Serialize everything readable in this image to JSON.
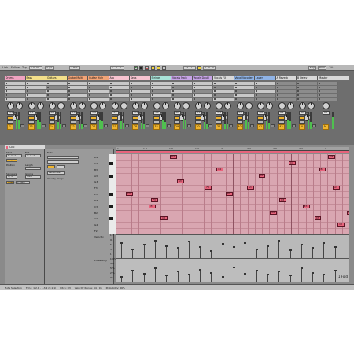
{
  "transport": {
    "link": "Link",
    "follow": "Follow",
    "tap": "Tap",
    "tempo": "120.00",
    "metre": "4 / 4",
    "quant": "1 Bar",
    "position": "1 . 1 . 1",
    "loop_start": "23 . 1 . 1",
    "loop_len": "4 . 0 . 0",
    "key": "Key",
    "midi": "MIDI",
    "cpu": "1%"
  },
  "tracks": [
    {
      "name": "Drums",
      "color": "#f0a3c1",
      "num": "1",
      "vol": "-3.4",
      "meter": 0.6
    },
    {
      "name": "Bass",
      "color": "#f4e08a",
      "num": "13",
      "vol": "-6.1",
      "meter": 0.5
    },
    {
      "name": "Guitars",
      "color": "#f4e08a",
      "num": "14",
      "vol": "-4.2",
      "meter": 0.4
    },
    {
      "name": "Guitar Multi",
      "color": "#f2a477",
      "num": "22",
      "vol": "-2.8",
      "meter": 0.3
    },
    {
      "name": "Guitar High",
      "color": "#f2a477",
      "num": "24",
      "vol": "-5.0",
      "meter": 0.55
    },
    {
      "name": "Arp",
      "color": "#f7c3d0",
      "num": "27",
      "vol": "-1.2",
      "meter": 0.45
    },
    {
      "name": "Keys",
      "color": "#f7c3d0",
      "num": "28",
      "vol": "-4.5",
      "meter": 0.35
    },
    {
      "name": "Strings",
      "color": "#a8e3d8",
      "num": "33",
      "vol": "-3.0",
      "meter": 0.5
    },
    {
      "name": "Vocals Main",
      "color": "#c7a4e6",
      "num": "29",
      "vol": "-6.0",
      "meter": 0.6
    },
    {
      "name": "Vocals Doubl",
      "color": "#c7a4e6",
      "num": "30",
      "vol": "-2.1",
      "meter": 0.4
    },
    {
      "name": "Vocals FX",
      "color": "#d9d9d9",
      "num": "36",
      "vol": "-7.5",
      "meter": 0.3
    },
    {
      "name": "Vocal Vocoder",
      "color": "#8fb3e6",
      "num": "40",
      "vol": "-3.3",
      "meter": 0.5
    },
    {
      "name": "Layer",
      "color": "#8fb3e6",
      "num": "41",
      "vol": "-4.0",
      "meter": 0.45
    },
    {
      "name": "A Reverb",
      "color": "#d9d9d9",
      "num": "42",
      "vol": "-6.2",
      "meter": 0.55
    },
    {
      "name": "B Delay",
      "color": "#d9d9d9",
      "num": "A",
      "vol": "-8.0",
      "meter": 0.5
    }
  ],
  "master": {
    "name": "Master",
    "num": "M",
    "vol": "0.0"
  },
  "sends_label": "Sends",
  "clip": {
    "title": "Clip",
    "start_label": "Start",
    "end_label": "End",
    "position_label": "Position",
    "length_label": "Length",
    "loop_label": "Loop",
    "signature_label": "Signature",
    "groove_label": "Groove",
    "scale_label": "Scale",
    "signature_value": "4 / 4",
    "groove_value": "None",
    "start_value": "1 . 1 . 1",
    "end_value": "5 . 1 . 1",
    "loop_value": "4 . 0 . 0",
    "scale_value": "C Major"
  },
  "notes_panel": {
    "title": "Notes",
    "randomize": "Randomize",
    "velocity_range": "Velocity Range"
  },
  "ruler": [
    "1",
    "1.2",
    "1.3",
    "1.4",
    "2",
    "2.2",
    "2.3",
    "2.4",
    "3"
  ],
  "pitch_labels": [
    "D4",
    "C4",
    "B3",
    "A3",
    "G3",
    "F3",
    "E3",
    "D3",
    "C3",
    "B2",
    "A2",
    "G2",
    "F2"
  ],
  "notes": [
    {
      "label": "G3",
      "pitch": 7,
      "start": 0.04,
      "len": 0.03
    },
    {
      "label": "E3",
      "pitch": 9,
      "start": 0.14,
      "len": 0.03
    },
    {
      "label": "F3",
      "pitch": 8,
      "start": 0.15,
      "len": 0.03
    },
    {
      "label": "C3",
      "pitch": 11,
      "start": 0.19,
      "len": 0.03
    },
    {
      "label": "D4",
      "pitch": 1,
      "start": 0.23,
      "len": 0.03
    },
    {
      "label": "A3",
      "pitch": 5,
      "start": 0.26,
      "len": 0.03
    },
    {
      "label": "F3",
      "pitch": 6,
      "start": 0.38,
      "len": 0.03
    },
    {
      "label": "C4",
      "pitch": 3,
      "start": 0.43,
      "len": 0.03
    },
    {
      "label": "E3",
      "pitch": 7,
      "start": 0.47,
      "len": 0.03
    },
    {
      "label": "G3",
      "pitch": 6,
      "start": 0.56,
      "len": 0.03
    },
    {
      "label": "A3",
      "pitch": 4,
      "start": 0.61,
      "len": 0.03
    },
    {
      "label": "G3",
      "pitch": 10,
      "start": 0.66,
      "len": 0.03
    },
    {
      "label": "D3",
      "pitch": 8,
      "start": 0.7,
      "len": 0.03
    },
    {
      "label": "C4",
      "pitch": 2,
      "start": 0.74,
      "len": 0.03
    },
    {
      "label": "E3",
      "pitch": 9,
      "start": 0.8,
      "len": 0.03
    },
    {
      "label": "D3",
      "pitch": 11,
      "start": 0.85,
      "len": 0.03
    },
    {
      "label": "B3",
      "pitch": 3,
      "start": 0.87,
      "len": 0.03
    },
    {
      "label": "D4",
      "pitch": 1,
      "start": 0.91,
      "len": 0.03
    },
    {
      "label": "A3",
      "pitch": 6,
      "start": 0.93,
      "len": 0.03
    },
    {
      "label": "C3",
      "pitch": 12,
      "start": 0.95,
      "len": 0.03
    },
    {
      "label": "F3",
      "pitch": 10,
      "start": 0.99,
      "len": 0.01
    }
  ],
  "velocity_label": "Velocity",
  "probability_label": "Probability",
  "velocity_scale": [
    "127",
    "96",
    "64",
    "32",
    "1"
  ],
  "probability_scale": [
    "100%",
    "75%",
    "50%",
    "25%",
    "0%"
  ],
  "velocities": [
    0.7,
    0.4,
    0.6,
    0.8,
    0.55,
    0.45,
    0.75,
    0.5,
    0.3,
    0.65,
    0.5,
    0.7,
    0.4,
    0.55,
    0.8,
    0.35,
    0.6,
    0.45,
    0.7,
    0.5
  ],
  "probabilities": [
    0.2,
    0.5,
    0.35,
    0.6,
    0.25,
    0.45,
    0.3,
    0.55,
    0.4,
    0.2,
    0.65,
    0.35,
    0.5,
    0.3,
    0.45,
    0.25,
    0.6,
    0.4,
    0.3,
    0.5
  ],
  "fold_label": "1 Fold",
  "status": {
    "selection": "Note Selection",
    "time": "Time: 1.2.1 - 1.3.2 (0.1.1)",
    "pitch": "Pitch: D3",
    "velocity": "Velocity Range: 64 - 96",
    "probability": "Probability: 66%"
  },
  "colors": {
    "note": "#e8637c",
    "grid": "#d9a6b1",
    "track_number": "#f0b52e",
    "background": "#6e6e6e"
  }
}
